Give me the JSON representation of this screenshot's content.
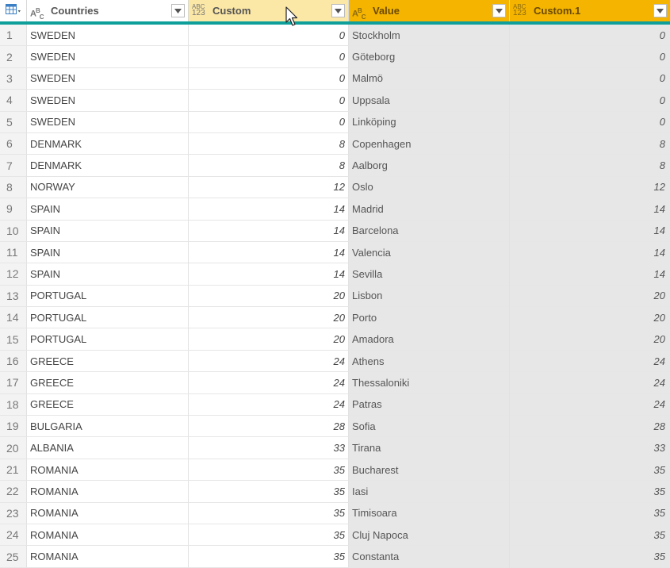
{
  "columns": [
    {
      "name": "Countries",
      "type_icon": "abc-text-icon"
    },
    {
      "name": "Custom",
      "type_icon": "abc123-any-icon"
    },
    {
      "name": "Value",
      "type_icon": "abc-text-icon"
    },
    {
      "name": "Custom.1",
      "type_icon": "abc123-any-icon"
    }
  ],
  "type_labels": {
    "abc_main": "A",
    "abc_sup": "B",
    "abc_sub": "C",
    "abc123_top": "ABC",
    "abc123_bottom": "123"
  },
  "colors": {
    "accent": "#0e9f9a",
    "selected_header": "#f4b400",
    "hover_header": "#fbe7a6",
    "selected_cells": "#e7e7e7"
  },
  "rows": [
    {
      "index": "1",
      "countries": "SWEDEN",
      "custom": "0",
      "value": "Stockholm",
      "custom1": "0"
    },
    {
      "index": "2",
      "countries": "SWEDEN",
      "custom": "0",
      "value": "Göteborg",
      "custom1": "0"
    },
    {
      "index": "3",
      "countries": "SWEDEN",
      "custom": "0",
      "value": "Malmö",
      "custom1": "0"
    },
    {
      "index": "4",
      "countries": "SWEDEN",
      "custom": "0",
      "value": "Uppsala",
      "custom1": "0"
    },
    {
      "index": "5",
      "countries": "SWEDEN",
      "custom": "0",
      "value": "Linköping",
      "custom1": "0"
    },
    {
      "index": "6",
      "countries": "DENMARK",
      "custom": "8",
      "value": "Copenhagen",
      "custom1": "8"
    },
    {
      "index": "7",
      "countries": "DENMARK",
      "custom": "8",
      "value": "Aalborg",
      "custom1": "8"
    },
    {
      "index": "8",
      "countries": "NORWAY",
      "custom": "12",
      "value": "Oslo",
      "custom1": "12"
    },
    {
      "index": "9",
      "countries": "SPAIN",
      "custom": "14",
      "value": "Madrid",
      "custom1": "14"
    },
    {
      "index": "10",
      "countries": "SPAIN",
      "custom": "14",
      "value": "Barcelona",
      "custom1": "14"
    },
    {
      "index": "11",
      "countries": "SPAIN",
      "custom": "14",
      "value": "Valencia",
      "custom1": "14"
    },
    {
      "index": "12",
      "countries": "SPAIN",
      "custom": "14",
      "value": "Sevilla",
      "custom1": "14"
    },
    {
      "index": "13",
      "countries": "PORTUGAL",
      "custom": "20",
      "value": "Lisbon",
      "custom1": "20"
    },
    {
      "index": "14",
      "countries": "PORTUGAL",
      "custom": "20",
      "value": "Porto",
      "custom1": "20"
    },
    {
      "index": "15",
      "countries": "PORTUGAL",
      "custom": "20",
      "value": "Amadora",
      "custom1": "20"
    },
    {
      "index": "16",
      "countries": "GREECE",
      "custom": "24",
      "value": "Athens",
      "custom1": "24"
    },
    {
      "index": "17",
      "countries": "GREECE",
      "custom": "24",
      "value": "Thessaloniki",
      "custom1": "24"
    },
    {
      "index": "18",
      "countries": "GREECE",
      "custom": "24",
      "value": "Patras",
      "custom1": "24"
    },
    {
      "index": "19",
      "countries": "BULGARIA",
      "custom": "28",
      "value": "Sofia",
      "custom1": "28"
    },
    {
      "index": "20",
      "countries": "ALBANIA",
      "custom": "33",
      "value": "Tirana",
      "custom1": "33"
    },
    {
      "index": "21",
      "countries": "ROMANIA",
      "custom": "35",
      "value": "Bucharest",
      "custom1": "35"
    },
    {
      "index": "22",
      "countries": "ROMANIA",
      "custom": "35",
      "value": "Iasi",
      "custom1": "35"
    },
    {
      "index": "23",
      "countries": "ROMANIA",
      "custom": "35",
      "value": "Timisoara",
      "custom1": "35"
    },
    {
      "index": "24",
      "countries": "ROMANIA",
      "custom": "35",
      "value": "Cluj Napoca",
      "custom1": "35"
    },
    {
      "index": "25",
      "countries": "ROMANIA",
      "custom": "35",
      "value": "Constanta",
      "custom1": "35"
    }
  ]
}
